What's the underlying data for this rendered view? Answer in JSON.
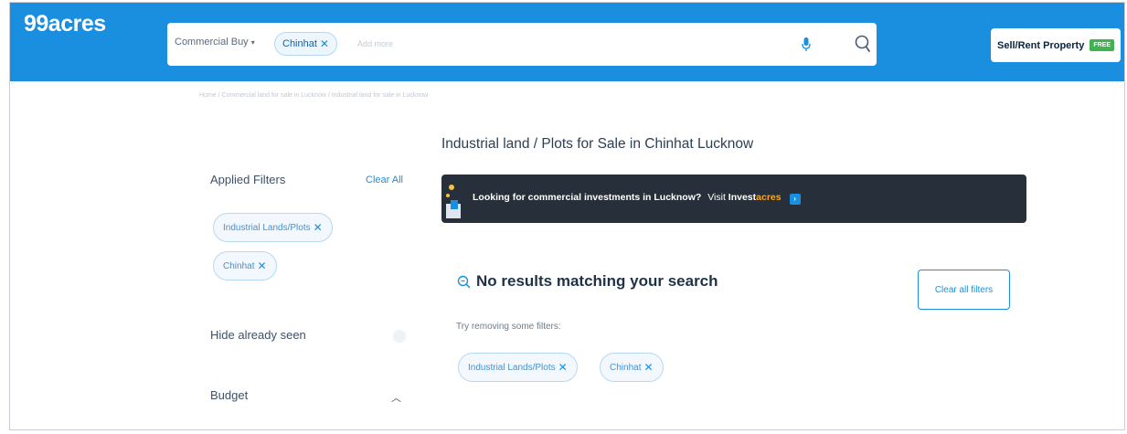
{
  "header": {
    "logo": "99acres",
    "search": {
      "property_type": "Commercial Buy",
      "location_chip": "Chinhat",
      "add_more_placeholder": "Add more"
    },
    "sell_button": {
      "label": "Sell/Rent Property",
      "badge": "FREE"
    }
  },
  "breadcrumb": "Home / Commercial land for sale in Lucknow / Industrial land for sale in Lucknow",
  "page_title": "Industrial land / Plots for Sale in Chinhat Lucknow",
  "filters": {
    "heading": "Applied Filters",
    "clear_all": "Clear All",
    "applied": [
      "Industrial Lands/Plots",
      "Chinhat"
    ],
    "hide_seen": "Hide already seen",
    "budget": "Budget"
  },
  "banner": {
    "text": "Looking for commercial investments in Lucknow?",
    "visit": "Visit",
    "brand_part1": "Invest",
    "brand_part2": "acres"
  },
  "results": {
    "heading": "No results matching your search",
    "hint": "Try removing some filters:",
    "chips": [
      "Industrial Lands/Plots",
      "Chinhat"
    ],
    "clear_all_filters": "Clear all filters"
  },
  "colors": {
    "header_blue": "#1a8fe0",
    "banner_dark": "#27303a",
    "accent_orange": "#f5a623",
    "free_green": "#3fb34f"
  }
}
